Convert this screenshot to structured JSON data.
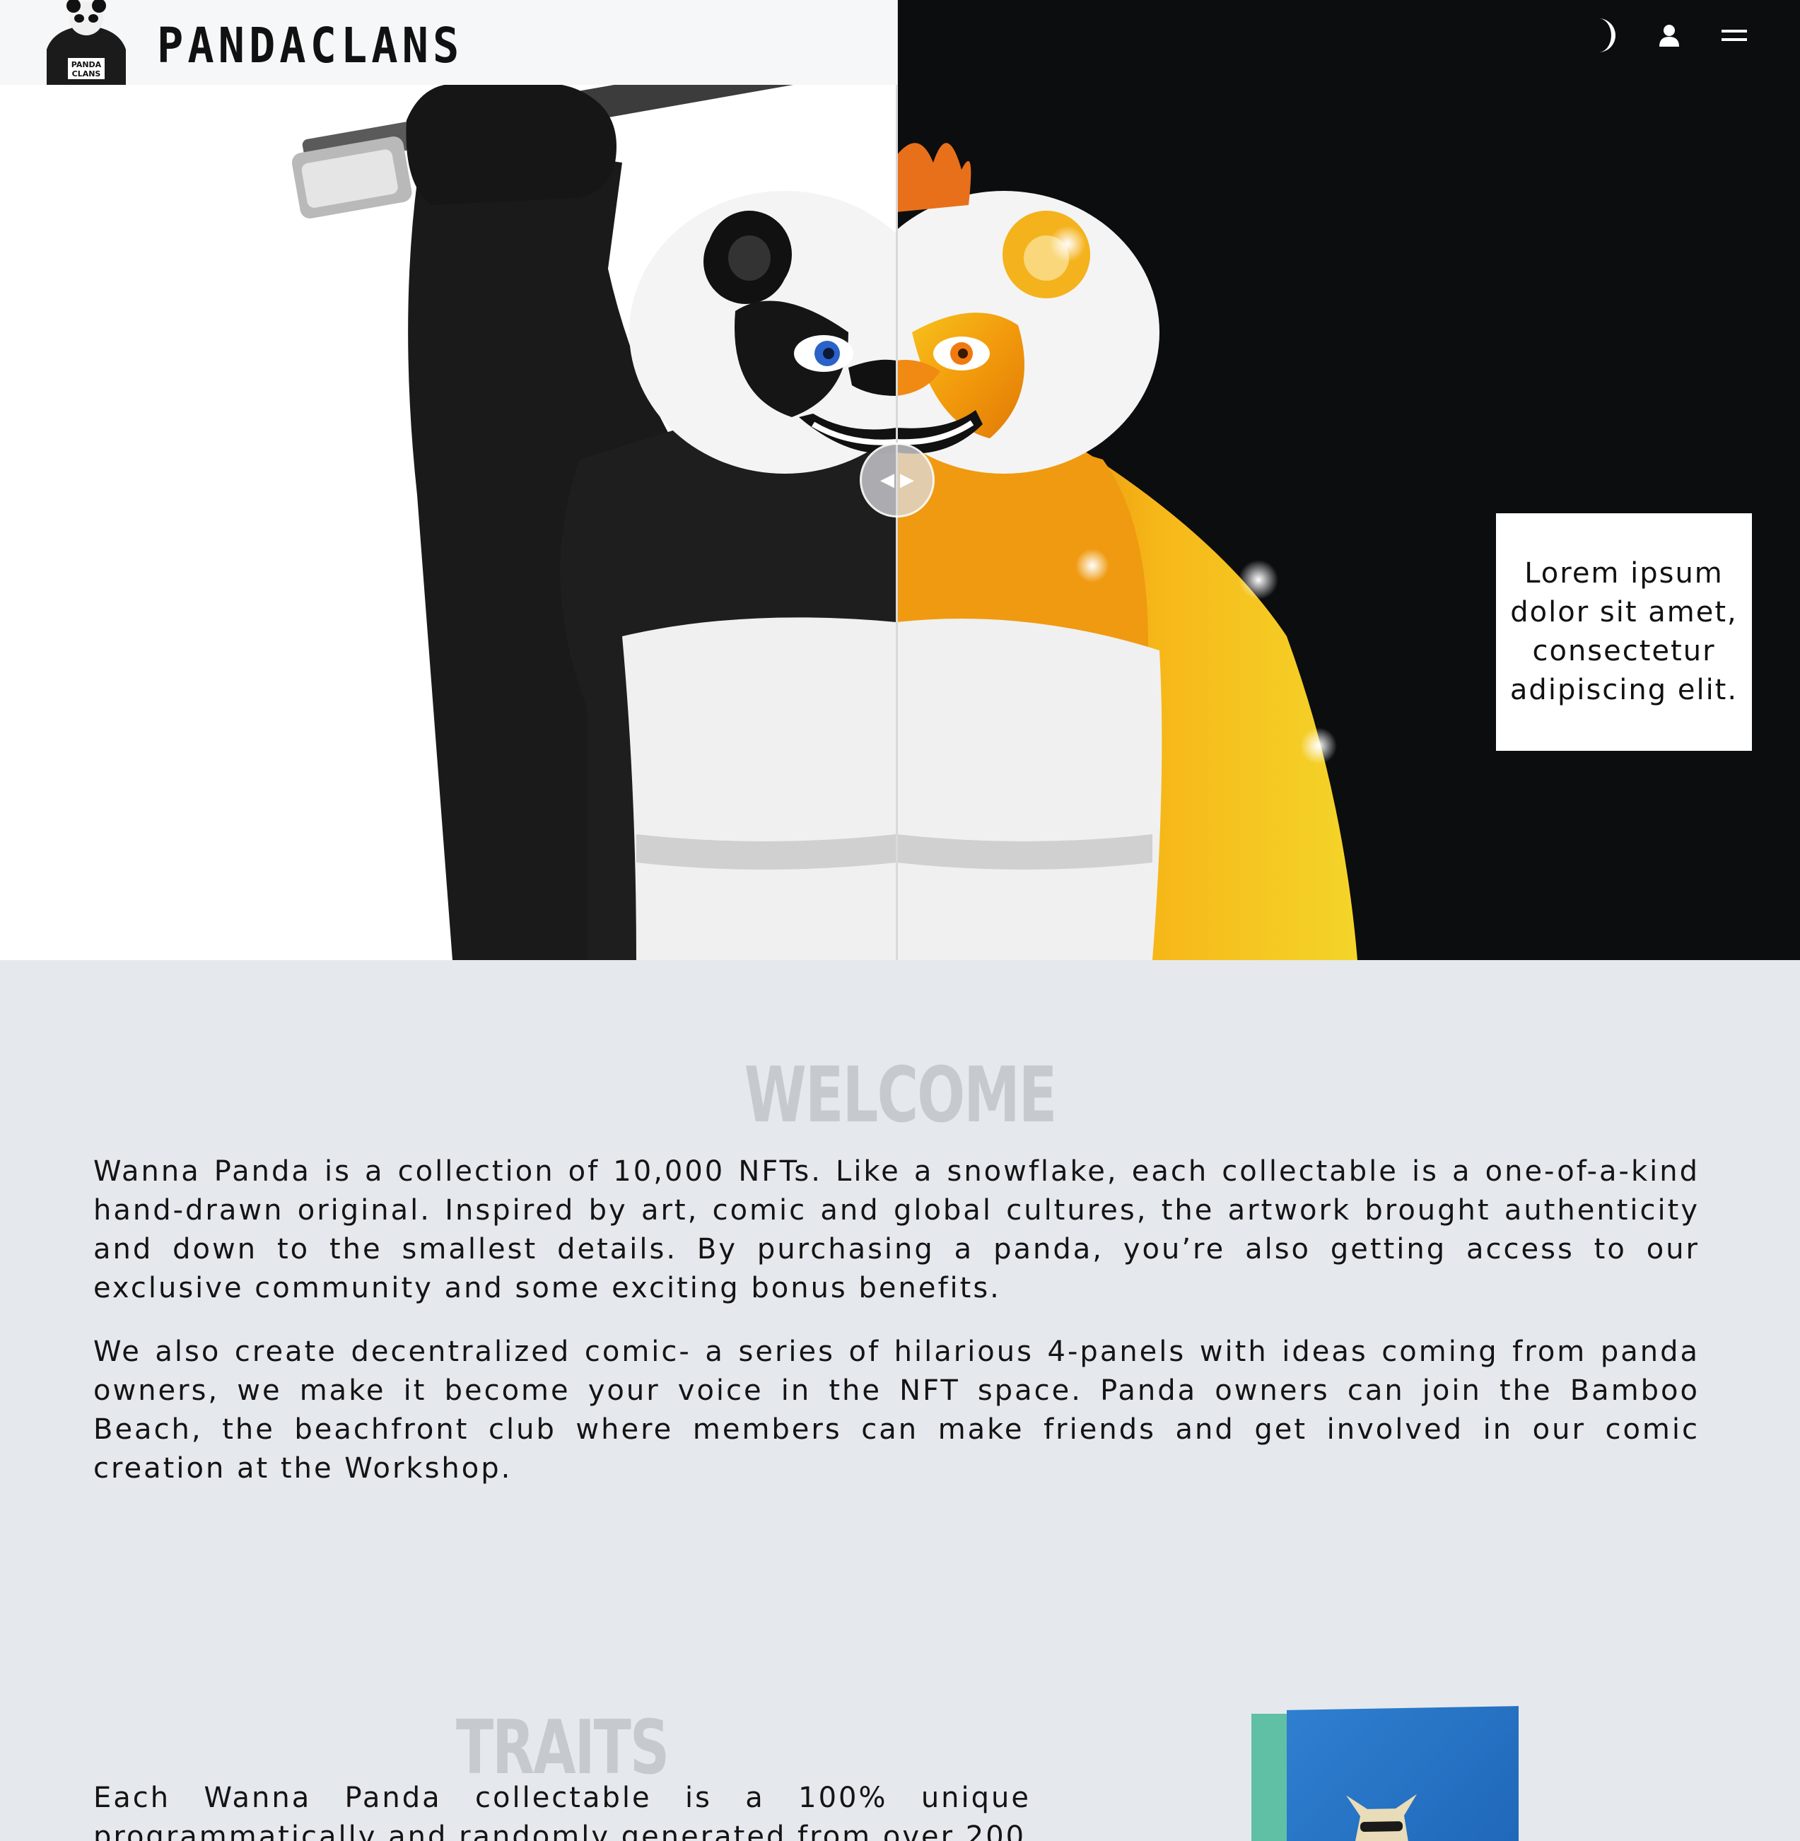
{
  "header": {
    "brand": "PANDACLANS",
    "logo_text": "PANDA CLANS",
    "icons": [
      "moon-icon",
      "user-icon",
      "menu-icon"
    ]
  },
  "hero": {
    "caption": "Lorem ipsum dolor sit amet, consectetur adipiscing elit.",
    "left_bg": "#ffffff",
    "right_bg": "#0c0d0f",
    "accent": "#f2a413"
  },
  "welcome": {
    "title": "WELCOME",
    "paragraphs": [
      "Wanna Panda is a collection of 10,000 NFTs. Like a snowflake, each collectable is a one-of-a-kind hand-drawn original. Inspired by art, comic and global cultures, the artwork brought authenticity and down to the smallest details. By purchasing a panda, you’re also getting access to our exclusive community and some exciting bonus benefits.",
      "We also create decentralized comic- a series of hilarious 4-panels with ideas coming from panda owners, we make it become your voice in the NFT space. Panda owners can join the Bamboo Beach, the beachfront club where members can make friends and get involved in our comic creation at the Workshop."
    ]
  },
  "traits": {
    "title": "TRAITS",
    "text": "Each Wanna Panda collectable is a 100% unique programmatically and randomly generated from over 200"
  }
}
